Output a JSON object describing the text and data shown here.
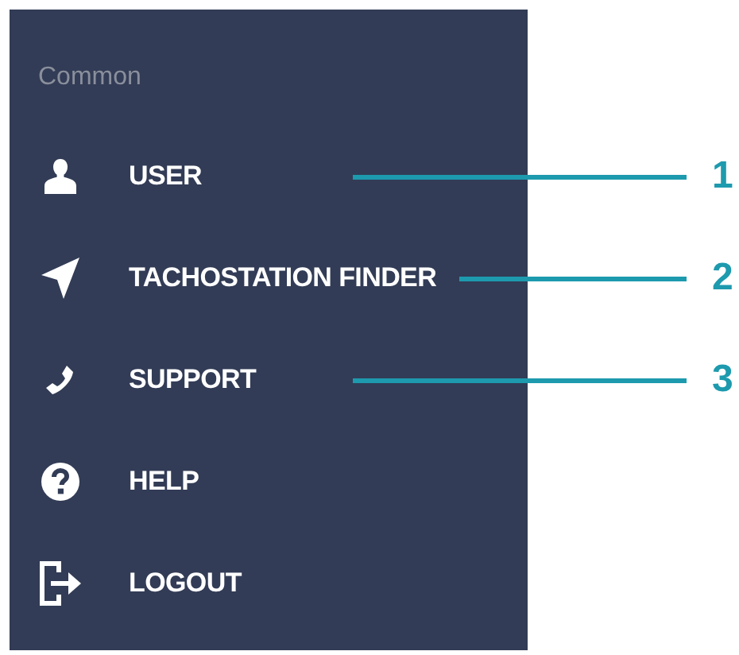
{
  "sidebar": {
    "heading": "Common",
    "items": [
      {
        "label": "USER",
        "callout": "1"
      },
      {
        "label": "TACHOSTATION FINDER",
        "callout": "2"
      },
      {
        "label": "SUPPORT",
        "callout": "3"
      },
      {
        "label": "HELP"
      },
      {
        "label": "LOGOUT"
      }
    ]
  }
}
